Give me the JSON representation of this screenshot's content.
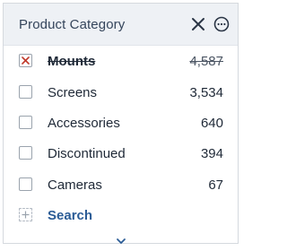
{
  "filter": {
    "title": "Product Category",
    "close_icon": "close-icon",
    "more_icon": "more-options-icon",
    "items": [
      {
        "label": "Mounts",
        "count": "4,587",
        "state": "excluded"
      },
      {
        "label": "Screens",
        "count": "3,534",
        "state": "unchecked"
      },
      {
        "label": "Accessories",
        "count": "640",
        "state": "unchecked"
      },
      {
        "label": "Discontinued",
        "count": "394",
        "state": "unchecked"
      },
      {
        "label": "Cameras",
        "count": "67",
        "state": "unchecked"
      }
    ],
    "search_label": "Search",
    "colors": {
      "header_bg": "#eef1f5",
      "accent": "#2b5c96",
      "exclude_mark": "#c0392b"
    }
  }
}
